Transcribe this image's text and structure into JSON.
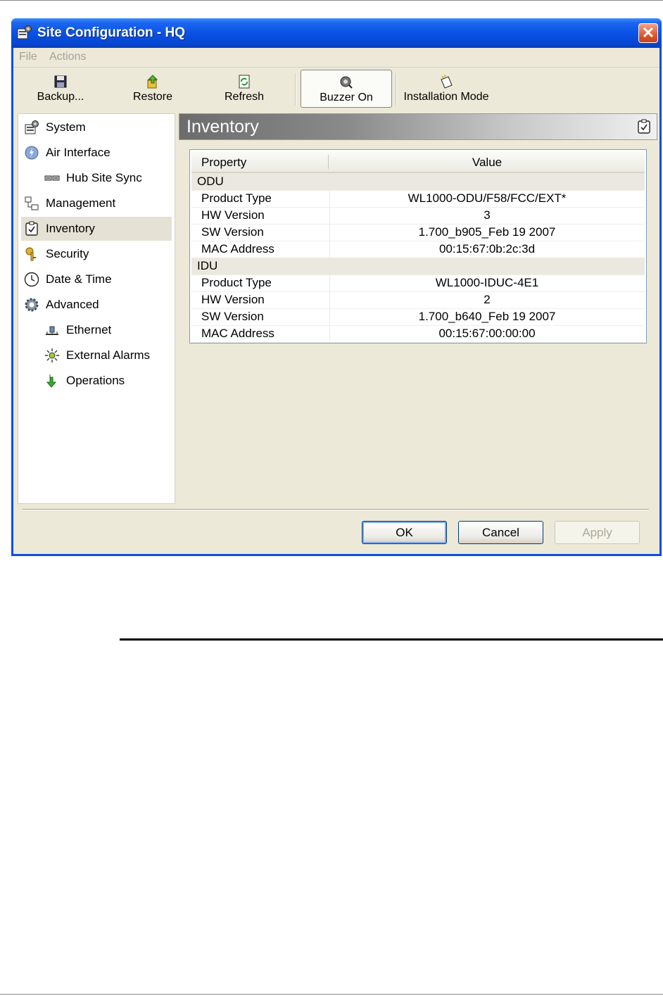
{
  "window": {
    "title": "Site Configuration - HQ"
  },
  "menu": {
    "file": "File",
    "actions": "Actions"
  },
  "toolbar": {
    "backup": "Backup...",
    "restore": "Restore",
    "refresh": "Refresh",
    "buzzer": "Buzzer On",
    "installation": "Installation Mode"
  },
  "nav": {
    "items": [
      {
        "label": "System",
        "icon": "system-icon"
      },
      {
        "label": "Air Interface",
        "icon": "air-interface-icon"
      },
      {
        "label": "Hub Site Sync",
        "icon": "hub-sync-icon"
      },
      {
        "label": "Management",
        "icon": "management-icon"
      },
      {
        "label": "Inventory",
        "icon": "inventory-icon",
        "selected": true
      },
      {
        "label": "Security",
        "icon": "security-icon"
      },
      {
        "label": "Date & Time",
        "icon": "clock-icon"
      },
      {
        "label": "Advanced",
        "icon": "gear-icon"
      },
      {
        "label": "Ethernet",
        "icon": "ethernet-icon"
      },
      {
        "label": "External Alarms",
        "icon": "alarm-icon"
      },
      {
        "label": "Operations",
        "icon": "operations-icon"
      }
    ]
  },
  "panel": {
    "title": "Inventory"
  },
  "table": {
    "headers": [
      "Property",
      "Value"
    ],
    "groups": [
      {
        "name": "ODU",
        "rows": [
          {
            "property": "Product Type",
            "value": "WL1000-ODU/F58/FCC/EXT*"
          },
          {
            "property": "HW Version",
            "value": "3"
          },
          {
            "property": "SW Version",
            "value": "1.700_b905_Feb 19 2007"
          },
          {
            "property": "MAC Address",
            "value": "00:15:67:0b:2c:3d"
          }
        ]
      },
      {
        "name": "IDU",
        "rows": [
          {
            "property": "Product Type",
            "value": "WL1000-IDUC-4E1"
          },
          {
            "property": "HW Version",
            "value": "2"
          },
          {
            "property": "SW Version",
            "value": "1.700_b640_Feb 19 2007"
          },
          {
            "property": "MAC Address",
            "value": "00:15:67:00:00:00"
          }
        ]
      }
    ]
  },
  "buttons": {
    "ok": "OK",
    "cancel": "Cancel",
    "apply": "Apply"
  },
  "colors": {
    "titlebar": "#0a52e6",
    "window_bg": "#ece9d8"
  }
}
